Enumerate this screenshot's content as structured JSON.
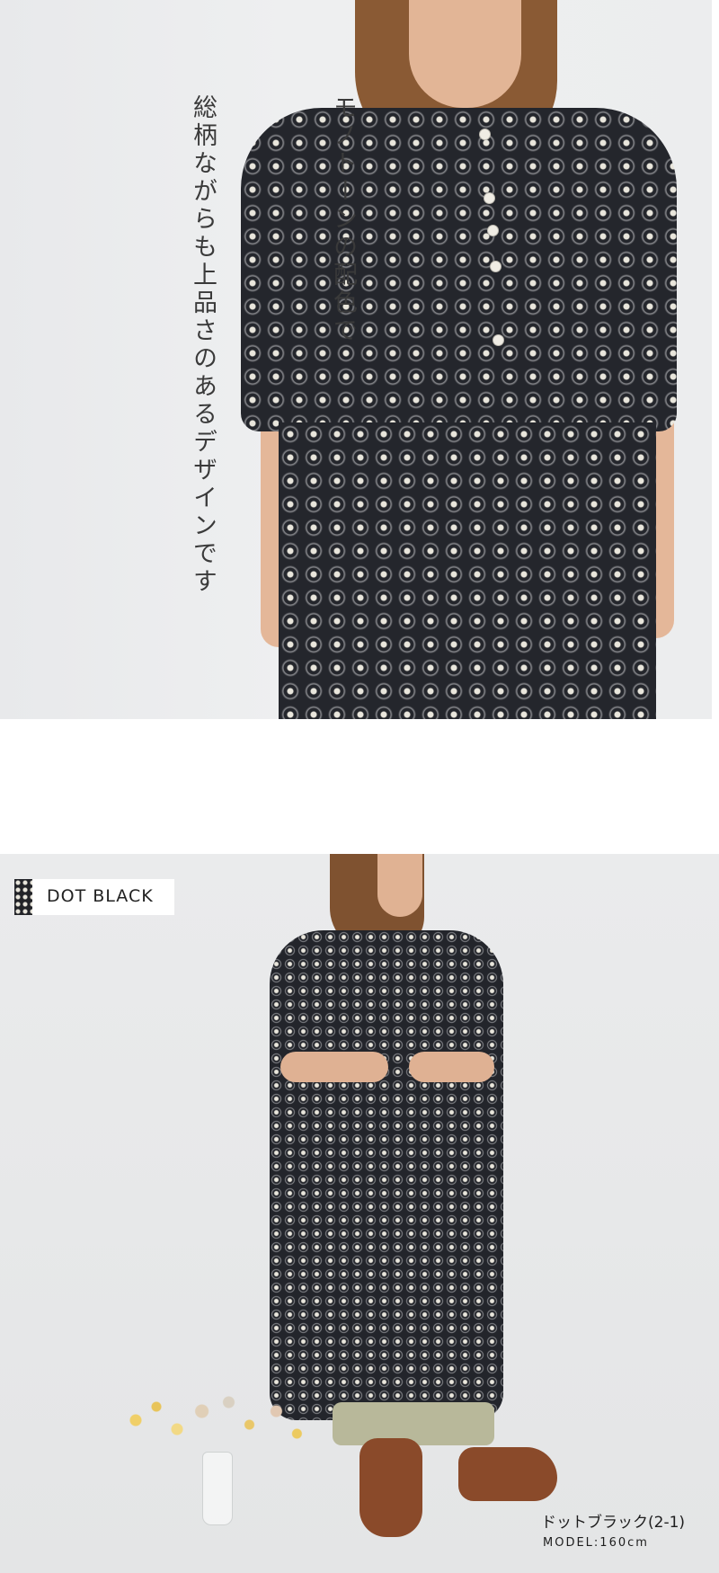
{
  "hero": {
    "caption_lines": [
      "モノトーンの配色で",
      "総柄ながらも上品さのあるデザインです"
    ]
  },
  "look": {
    "label": "DOT BLACK",
    "color_name": "ドットブラック(2-1)",
    "model_size": "MODEL:160cm"
  },
  "colors": {
    "dress": "#24262c",
    "dot": "#e9e6dc",
    "background": "#eceded"
  }
}
